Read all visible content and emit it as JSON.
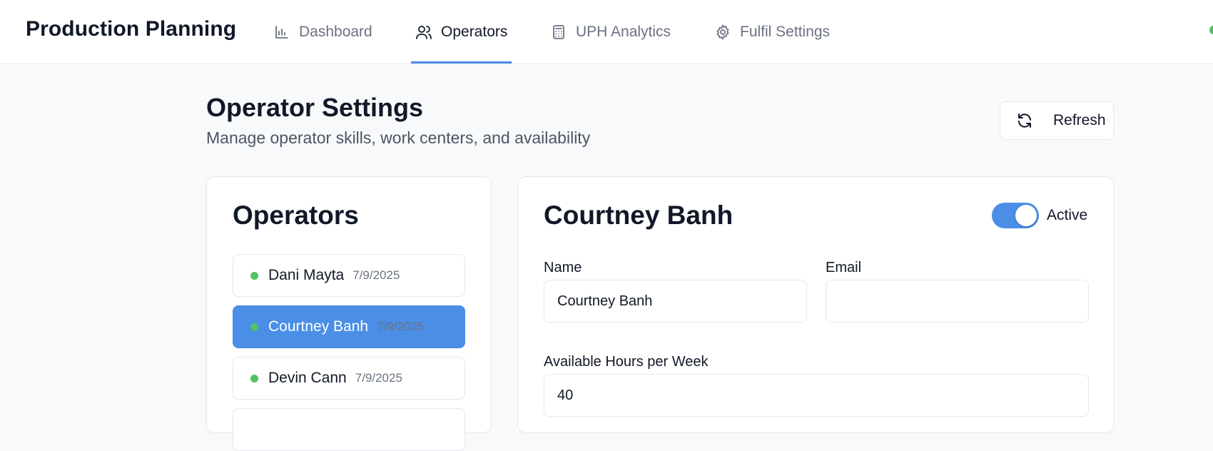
{
  "app": {
    "title": "Production Planning"
  },
  "nav": {
    "tabs": [
      {
        "label": "Dashboard",
        "icon": "bar-chart-icon",
        "active": false
      },
      {
        "label": "Operators",
        "icon": "users-icon",
        "active": true
      },
      {
        "label": "UPH Analytics",
        "icon": "calculator-icon",
        "active": false
      },
      {
        "label": "Fulfil Settings",
        "icon": "gear-icon",
        "active": false
      }
    ]
  },
  "header": {
    "title": "Operator Settings",
    "subtitle": "Manage operator skills, work centers, and availability",
    "refresh_label": "Refresh"
  },
  "operators": {
    "heading": "Operators",
    "items": [
      {
        "name": "Dani Mayta",
        "date": "7/9/2025",
        "selected": false
      },
      {
        "name": "Courtney Banh",
        "date": "7/9/2025",
        "selected": true
      },
      {
        "name": "Devin Cann",
        "date": "7/9/2025",
        "selected": false
      }
    ]
  },
  "detail": {
    "heading": "Courtney Banh",
    "active": true,
    "active_label": "Active",
    "name_label": "Name",
    "name_value": "Courtney Banh",
    "email_label": "Email",
    "email_value": "",
    "hours_label": "Available Hours per Week",
    "hours_value": "40"
  },
  "colors": {
    "accent": "#4a8ee6",
    "status_active": "#52c263"
  }
}
